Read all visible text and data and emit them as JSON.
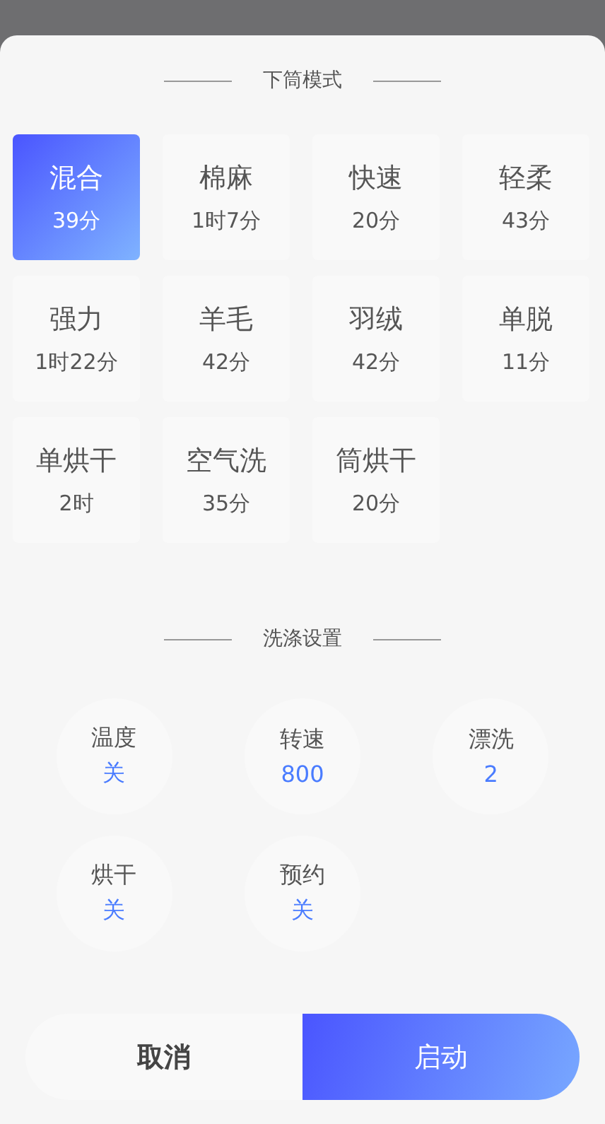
{
  "mode_section": {
    "title": "下筒模式"
  },
  "modes": [
    {
      "name": "混合",
      "duration": "39分",
      "selected": true
    },
    {
      "name": "棉麻",
      "duration": "1时7分",
      "selected": false
    },
    {
      "name": "快速",
      "duration": "20分",
      "selected": false
    },
    {
      "name": "轻柔",
      "duration": "43分",
      "selected": false
    },
    {
      "name": "强力",
      "duration": "1时22分",
      "selected": false
    },
    {
      "name": "羊毛",
      "duration": "42分",
      "selected": false
    },
    {
      "name": "羽绒",
      "duration": "42分",
      "selected": false
    },
    {
      "name": "单脱",
      "duration": "11分",
      "selected": false
    },
    {
      "name": "单烘干",
      "duration": "2时",
      "selected": false
    },
    {
      "name": "空气洗",
      "duration": "35分",
      "selected": false
    },
    {
      "name": "筒烘干",
      "duration": "20分",
      "selected": false
    }
  ],
  "settings_section": {
    "title": "洗涤设置"
  },
  "settings": [
    {
      "label": "温度",
      "value": "关"
    },
    {
      "label": "转速",
      "value": "800"
    },
    {
      "label": "漂洗",
      "value": "2"
    },
    {
      "label": "烘干",
      "value": "关"
    },
    {
      "label": "预约",
      "value": "关"
    }
  ],
  "buttons": {
    "cancel": "取消",
    "start": "启动"
  }
}
